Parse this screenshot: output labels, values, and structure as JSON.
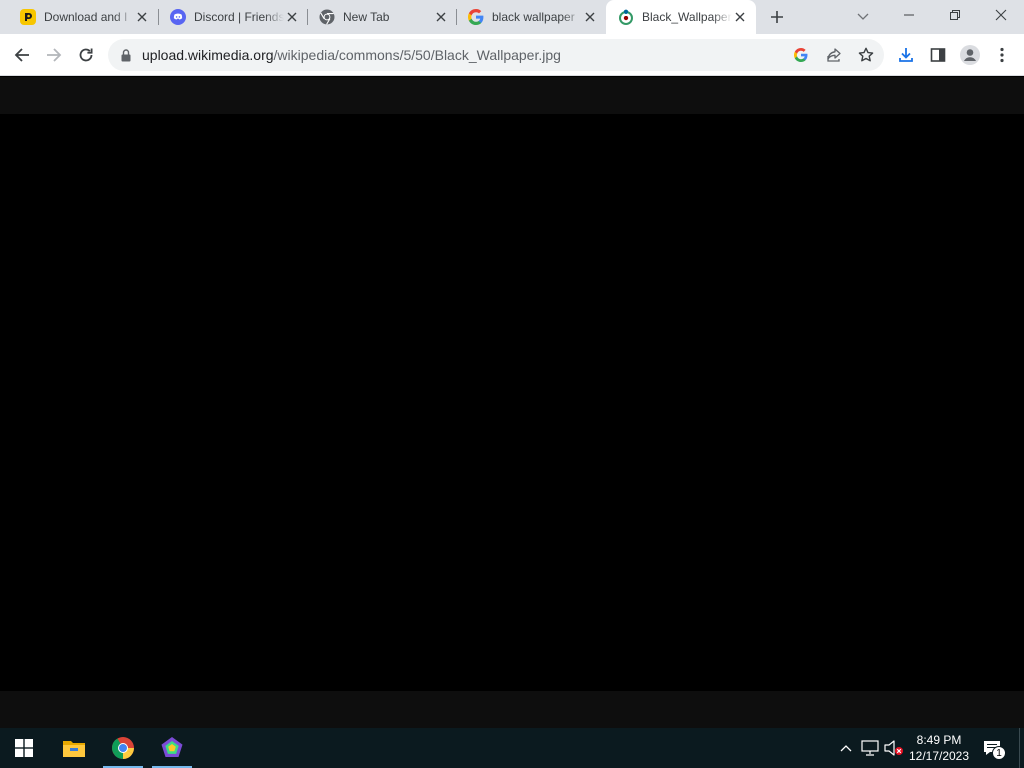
{
  "browser": {
    "tabs": [
      {
        "title": "Download and I",
        "favicon": "yellow-app-icon",
        "active": false
      },
      {
        "title": "Discord | Friends",
        "favicon": "discord-icon",
        "active": false
      },
      {
        "title": "New Tab",
        "favicon": "chrome-icon",
        "active": false
      },
      {
        "title": "black wallpaper",
        "favicon": "google-icon",
        "active": false
      },
      {
        "title": "Black_Wallpaper",
        "favicon": "wikimedia-icon",
        "active": true
      }
    ],
    "url": {
      "host": "upload.wikimedia.org",
      "path": "/wikipedia/commons/5/50/Black_Wallpaper.jpg"
    }
  },
  "taskbar": {
    "apps": [
      "windows-start-icon",
      "file-explorer-icon",
      "chrome-icon",
      "app-icon"
    ],
    "time": "8:49 PM",
    "date": "12/17/2023",
    "notification_count": "1"
  },
  "colors": {
    "tabstrip": "#dee1e6",
    "active_tab": "#ffffff",
    "viewer_bg": "#0e0e0e",
    "image": "#000000",
    "taskbar": "#0b1a1f"
  }
}
